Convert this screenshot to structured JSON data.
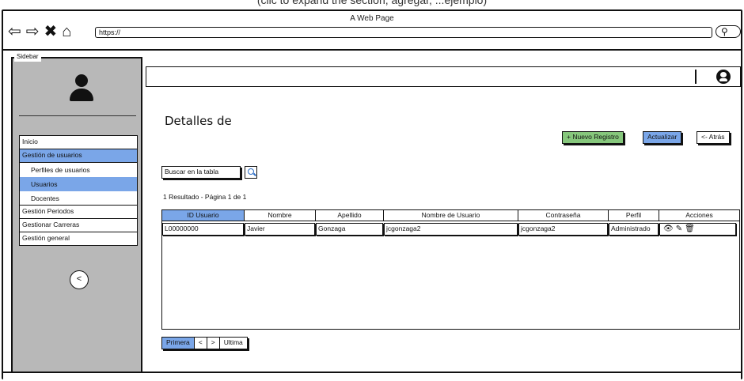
{
  "caption": "(clic to expand the section, agregar, ...ejemplo)",
  "browser": {
    "title": "A Web Page",
    "url": "https://",
    "nav_icons": [
      "back-arrow-icon",
      "forward-arrow-icon",
      "close-x-icon",
      "home-icon"
    ]
  },
  "sidebar": {
    "legend": "Sidebar",
    "menu": [
      {
        "label": "Inicio"
      },
      {
        "label": "Gestión de usuarios",
        "active": true
      },
      {
        "label": "Perfiles de usuarios",
        "sub": true
      },
      {
        "label": "Usuarios",
        "sub": true,
        "active": true
      },
      {
        "label": "Docentes",
        "sub": true
      },
      {
        "label": "Gestión Periodos"
      },
      {
        "label": "Gestionar Carreras"
      },
      {
        "label": "Gestión general"
      }
    ],
    "collapse_label": "<"
  },
  "page": {
    "title": "Detalles de",
    "buttons": {
      "new": "+ Nuevo Registro",
      "refresh": "Actualizar",
      "back": "<- Atrás"
    },
    "search_label": "Buscar en la tabla",
    "result_text": "1 Resultado - Página 1 de 1"
  },
  "table": {
    "columns": [
      "ID Usuario",
      "Nombre",
      "Apellido",
      "Nombre de Usuario",
      "Contraseña",
      "Perfil",
      "Acciones"
    ],
    "rows": [
      [
        "L00000000",
        "Javier",
        "Gonzaga",
        "jcgonzaga2",
        "jcgonzaga2",
        "Administrado"
      ]
    ],
    "action_icons": [
      "eye-icon",
      "edit-icon",
      "trash-icon"
    ]
  },
  "pager": [
    "Primera",
    "<",
    ">",
    "Ultima"
  ],
  "colors": {
    "accent_blue": "#7aa6e8",
    "green": "#86c77c",
    "sidebar_gray": "#b8b8b8"
  }
}
